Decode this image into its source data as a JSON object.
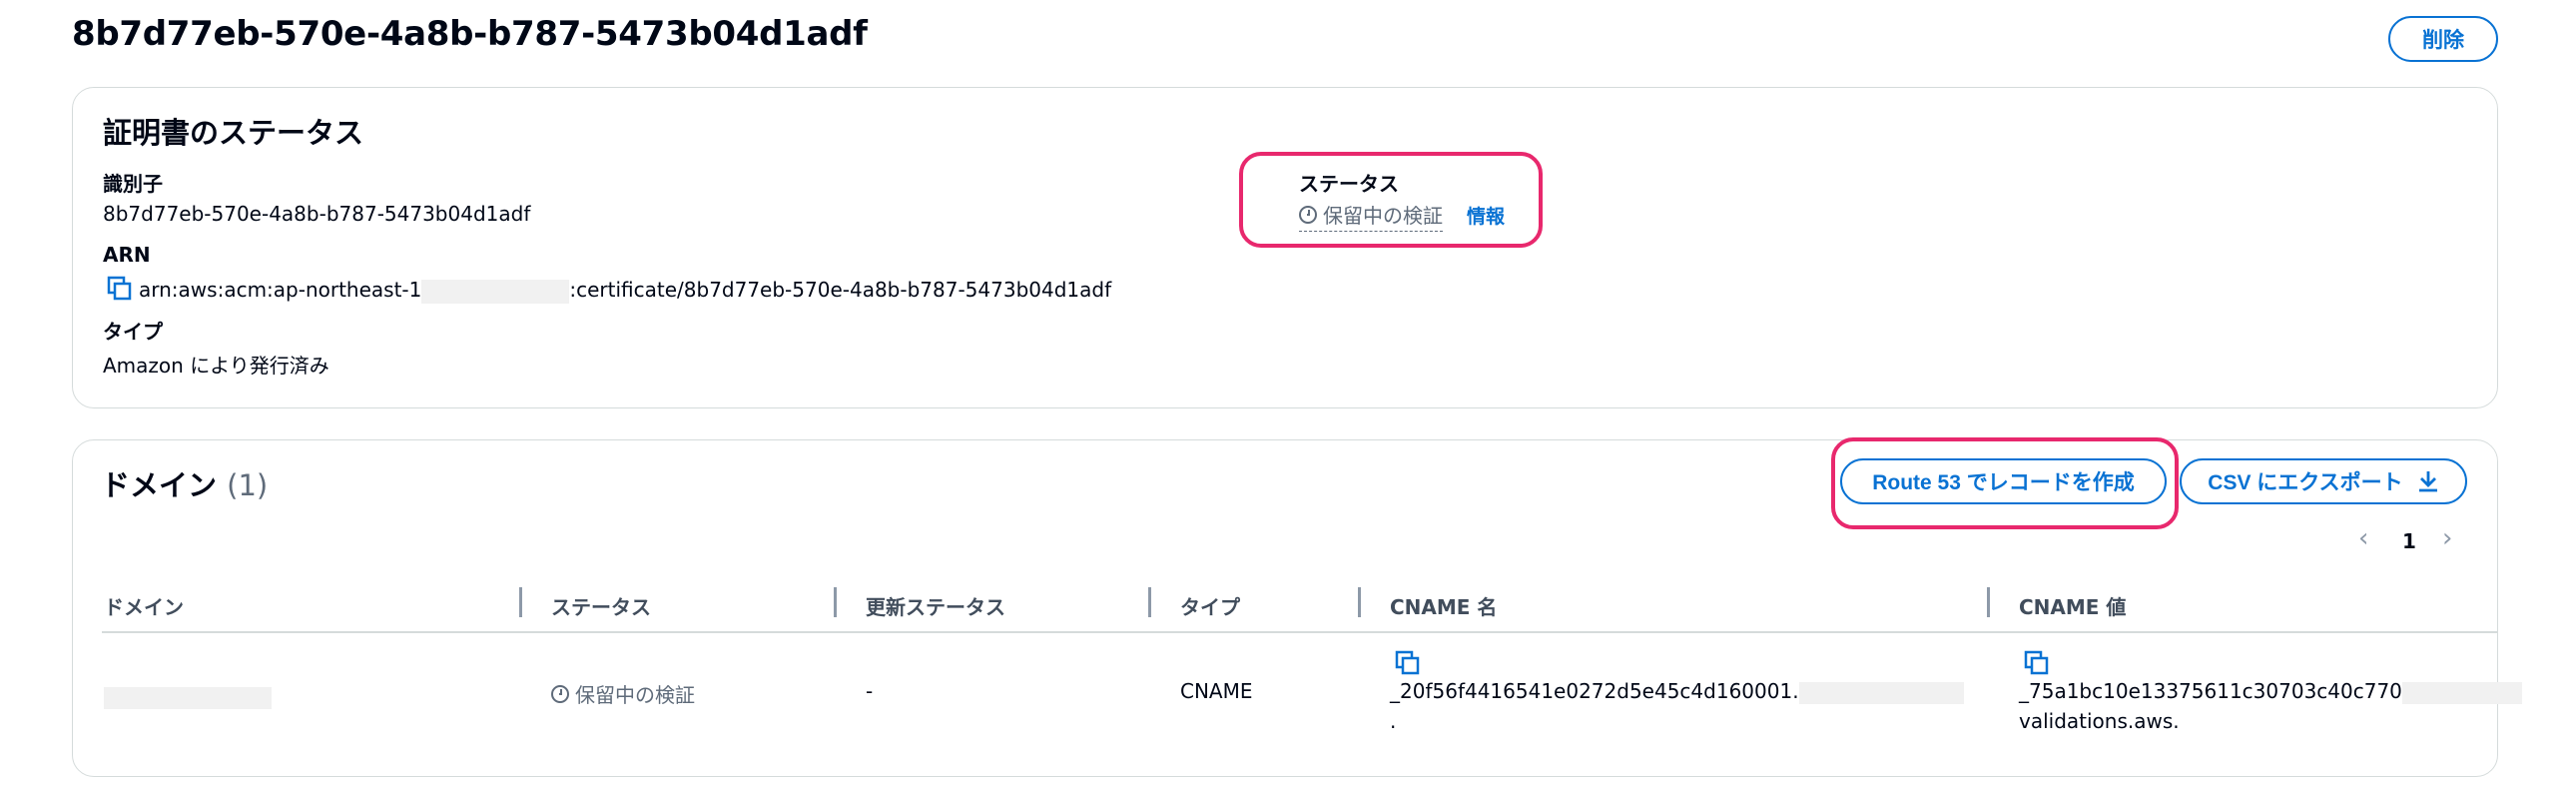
{
  "page": {
    "title": "8b7d77eb-570e-4a8b-b787-5473b04d1adf",
    "delete_label": "削除"
  },
  "status_card": {
    "heading": "証明書のステータス",
    "identifier_label": "識別子",
    "identifier_value": "8b7d77eb-570e-4a8b-b787-5473b04d1adf",
    "arn_label": "ARN",
    "arn_prefix": "arn:aws:acm:ap-northeast-1",
    "arn_suffix": ":certificate/8b7d77eb-570e-4a8b-b787-5473b04d1adf",
    "type_label": "タイプ",
    "type_value": "Amazon により発行済み",
    "status_label": "ステータス",
    "status_value": "保留中の検証",
    "info_link": "情報"
  },
  "domain_card": {
    "heading": "ドメイン",
    "count": "(1)",
    "route53_label": "Route 53 でレコードを作成",
    "csv_label": "CSV にエクスポート",
    "page_number": "1",
    "columns": [
      "ドメイン",
      "ステータス",
      "更新ステータス",
      "タイプ",
      "CNAME 名",
      "CNAME 値"
    ],
    "row": {
      "status": "保留中の検証",
      "renewal_status": "-",
      "type": "CNAME",
      "cname_name_line1": "_20f56f4416541e0272d5e45c4d160001.",
      "cname_name_line2": ".",
      "cname_value_line1": "_75a1bc10e13375611c30703c40c770",
      "cname_value_line2": "validations.aws."
    }
  },
  "colors": {
    "accent": "#0972d3",
    "highlight": "#e8286d",
    "muted": "#5f6b7a"
  }
}
